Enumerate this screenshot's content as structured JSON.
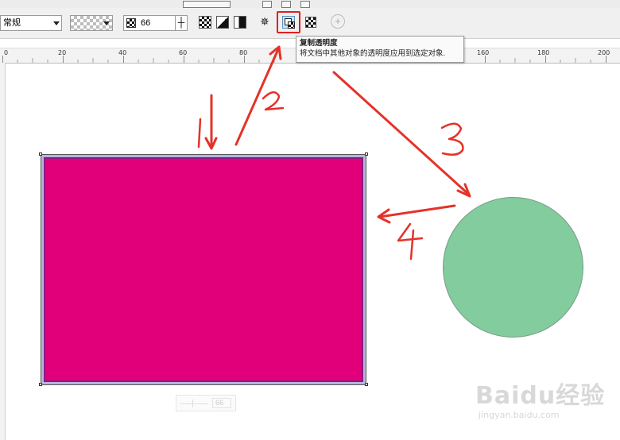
{
  "toolbar": {
    "merge_mode": "常规",
    "transparency_value": "66"
  },
  "tooltip": {
    "title": "复制透明度",
    "description": "将文档中其他对象的透明度应用到选定对象."
  },
  "ruler": {
    "labels": [
      "0",
      "20",
      "40",
      "60",
      "80",
      "160",
      "180",
      "200"
    ]
  },
  "annotations": {
    "labels": [
      "1",
      "2",
      "3",
      "4"
    ],
    "color": "#e53228"
  },
  "canvas": {
    "rectangle_color": "#e2007a",
    "circle_color": "#82cc9d",
    "slider_value": "66"
  },
  "watermark": {
    "brand": "Baidu经验",
    "url": "jingyan.baidu.com"
  }
}
